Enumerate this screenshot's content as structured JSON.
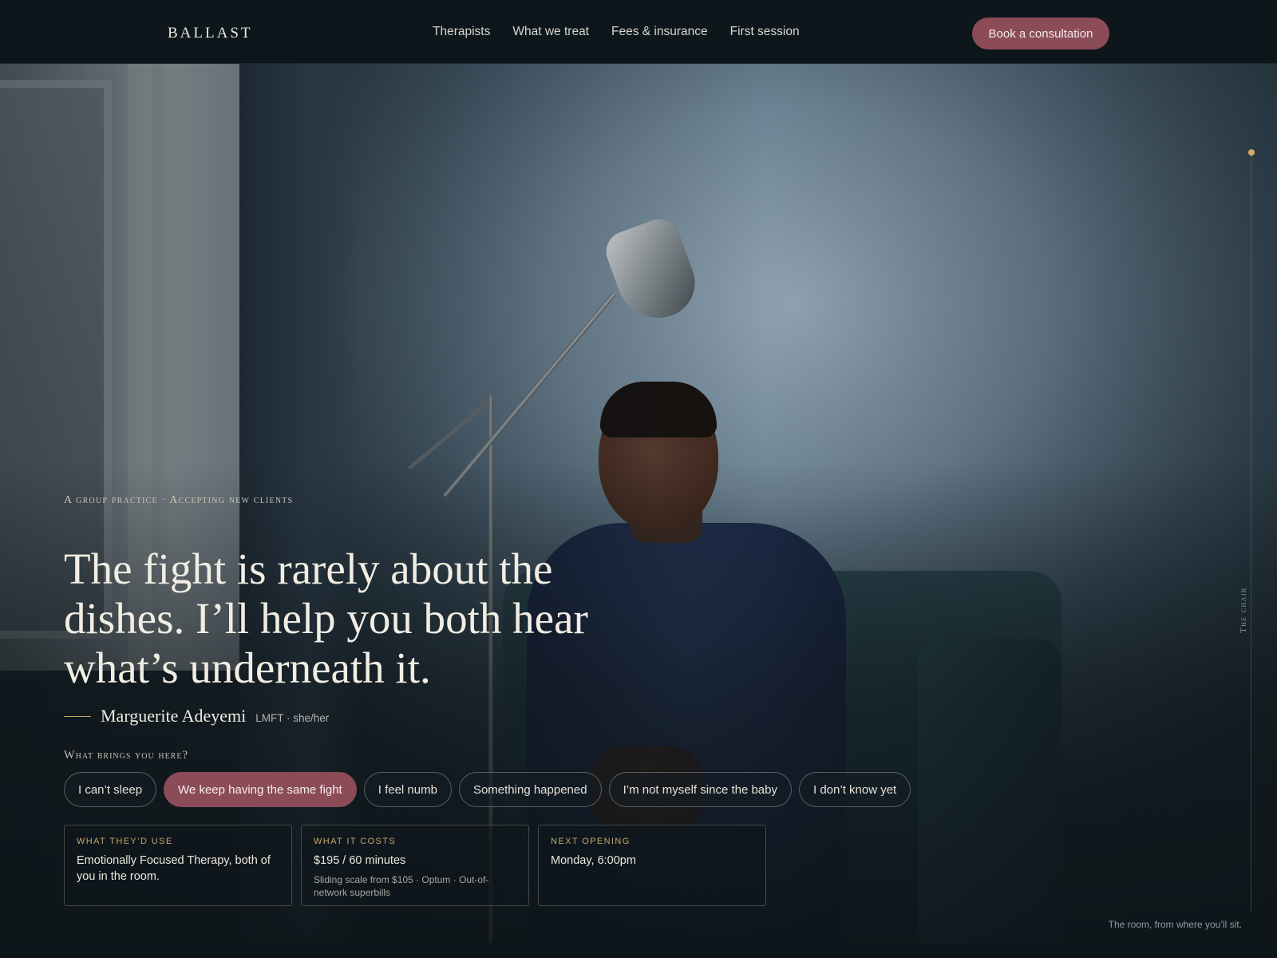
{
  "brand": {
    "logo": "BALLAST"
  },
  "nav": {
    "items": [
      "Therapists",
      "What we treat",
      "Fees & insurance",
      "First session"
    ],
    "cta_label": "Book a consultation"
  },
  "hero": {
    "eyebrow": "A group practice · Accepting new clients",
    "headline": "The fight is rarely about the dishes. I’ll help you both hear what’s underneath it.",
    "therapist_name": "Marguerite Adeyemi",
    "therapist_creds": "LMFT · she/her",
    "prompt_label": "What brings you here?",
    "chips": [
      {
        "label": "I can’t sleep",
        "selected": false
      },
      {
        "label": "We keep having the same fight",
        "selected": true
      },
      {
        "label": "I feel numb",
        "selected": false
      },
      {
        "label": "Something happened",
        "selected": false
      },
      {
        "label": "I’m not myself since the baby",
        "selected": false
      },
      {
        "label": "I don’t know yet",
        "selected": false
      }
    ],
    "cards": [
      {
        "key": "What they’d use",
        "value": "Emotionally Focused Therapy, both of you in the room.",
        "sub": ""
      },
      {
        "key": "What it costs",
        "value": "$195 / 60 minutes",
        "sub": "Sliding scale from $105 · Optum · Out-of-network superbills"
      },
      {
        "key": "Next opening",
        "value": "Monday, 6:00pm",
        "sub": ""
      }
    ]
  },
  "rail": {
    "label": "The chair"
  },
  "caption": "The room, from where you’ll sit.",
  "colors": {
    "accent": "#8b4c58",
    "gold": "#c6a66a",
    "background": "#0d161b"
  }
}
